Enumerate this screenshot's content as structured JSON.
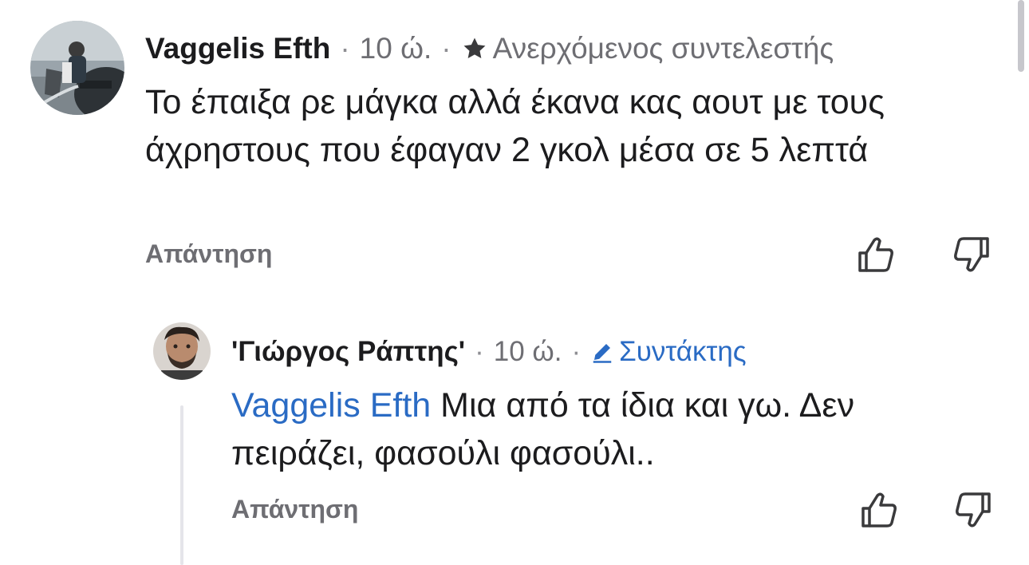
{
  "comments": [
    {
      "author": "Vaggelis Efth",
      "time": "10 ώ.",
      "separator": "·",
      "badge": "Ανερχόμενος συντελεστής",
      "badge_icon": "star-icon",
      "text": "Το έπαιξα ρε μάγκα αλλά έκανα κας αουτ με τους άχρηστους που έφαγαν 2 γκολ μέσα σε 5 λεπτά",
      "reply_label": "Απάντηση"
    },
    {
      "author": "'Γιώργος Ράπτης'",
      "time": "10 ώ.",
      "separator": "·",
      "badge": "Συντάκτης",
      "badge_icon": "pencil-icon",
      "mention": "Vaggelis Efth",
      "text": " Μια από τα ίδια και γω. Δεν πειράζει, φασούλι φασούλι..",
      "reply_label": "Απάντηση"
    }
  ],
  "colors": {
    "mention": "#2a6bc4",
    "meta": "#6e6e73",
    "icon": "#3a3a3c",
    "thread_line": "#e5e5ea"
  }
}
